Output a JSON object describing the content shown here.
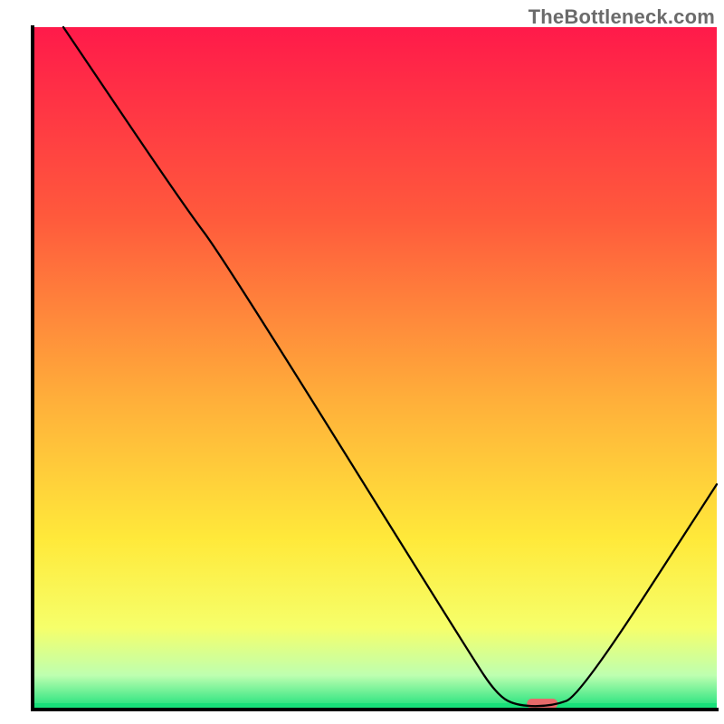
{
  "watermark": "TheBottleneck.com",
  "chart_data": {
    "type": "line",
    "title": "",
    "xlabel": "",
    "ylabel": "",
    "xlim": [
      0,
      100
    ],
    "ylim": [
      0,
      100
    ],
    "grid": false,
    "axes_visible": true,
    "background_gradient": {
      "stops": [
        {
          "offset": 0,
          "color": "#ff1a4a"
        },
        {
          "offset": 28,
          "color": "#ff5a3c"
        },
        {
          "offset": 55,
          "color": "#ffb03a"
        },
        {
          "offset": 75,
          "color": "#ffe93a"
        },
        {
          "offset": 88,
          "color": "#f6ff6a"
        },
        {
          "offset": 95,
          "color": "#beffb0"
        },
        {
          "offset": 100,
          "color": "#18e07a"
        }
      ]
    },
    "series": [
      {
        "name": "bottleneck-curve",
        "color": "#000000",
        "points": [
          {
            "x": 4.5,
            "y": 100
          },
          {
            "x": 22,
            "y": 74
          },
          {
            "x": 28,
            "y": 66
          },
          {
            "x": 64,
            "y": 8
          },
          {
            "x": 68,
            "y": 2
          },
          {
            "x": 71,
            "y": 0.5
          },
          {
            "x": 76,
            "y": 0.5
          },
          {
            "x": 80,
            "y": 2
          },
          {
            "x": 100,
            "y": 33
          }
        ]
      }
    ],
    "marker": {
      "name": "highlight-pill",
      "x": 74.5,
      "y": 0.2,
      "width_pct": 4.5,
      "color": "#e76a6a"
    }
  }
}
